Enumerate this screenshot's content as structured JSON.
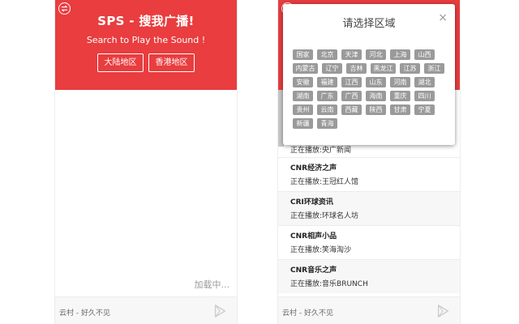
{
  "app": {
    "title": "SPS - 搜我广播!",
    "subtitle": "Search to Play the Sound !",
    "region_buttons": [
      "大陆地区",
      "香港地区"
    ],
    "loading_text": "加载中...",
    "accent_color": "#e93d3f"
  },
  "footer": {
    "text": "云村 - 好久不见",
    "play_icon": "play-triangle-icon"
  },
  "modal": {
    "title": "请选择区域",
    "close": "×",
    "regions": [
      "国家",
      "北京",
      "天津",
      "河北",
      "上海",
      "山西",
      "内蒙古",
      "辽宁",
      "吉林",
      "黑龙江",
      "江苏",
      "浙江",
      "安徽",
      "福建",
      "江西",
      "山东",
      "河南",
      "湖北",
      "湖南",
      "广东",
      "广西",
      "海南",
      "重庆",
      "四川",
      "贵州",
      "云南",
      "西藏",
      "陕西",
      "甘肃",
      "宁夏",
      "新疆",
      "青海"
    ]
  },
  "stations": {
    "first_now_playing": "正在播放:央广新闻",
    "items": [
      {
        "name": "CNR经济之声",
        "now": "正在播放:王冠红人馆"
      },
      {
        "name": "CRI环球资讯",
        "now": "正在播放:环球名人坊"
      },
      {
        "name": "CNR相声小品",
        "now": "正在播放:笑海淘沙"
      },
      {
        "name": "CNR音乐之声",
        "now": "正在播放:音乐BRUNCH"
      }
    ]
  }
}
